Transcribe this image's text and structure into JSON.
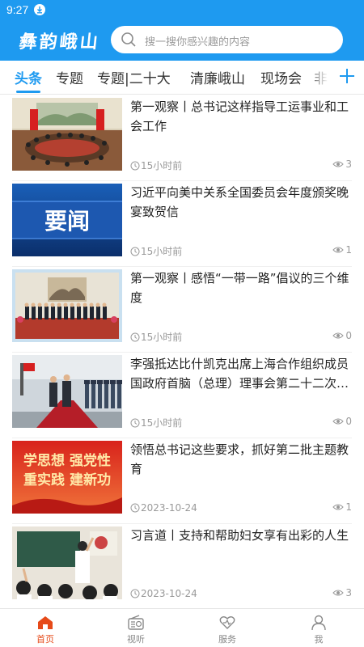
{
  "status": {
    "time": "9:27"
  },
  "header": {
    "logo": "彝韵峨山",
    "search_placeholder": "搜一搜你感兴趣的内容"
  },
  "tabs": [
    {
      "label": "头条",
      "active": true
    },
    {
      "label": "专题"
    },
    {
      "label": "专题|二十大"
    },
    {
      "label": "清廉峨山"
    },
    {
      "label": "现场会"
    },
    {
      "label": "非"
    }
  ],
  "thumb_text": {
    "news": "要闻",
    "slogan_1": "学思想  强党性",
    "slogan_2": "重实践  建新功"
  },
  "articles": [
    {
      "title": "第一观察丨总书记这样指导工运事业和工会工作",
      "time": "15小时前",
      "views": "3",
      "thumb": "meeting-room"
    },
    {
      "title": "习近平向美中关系全国委员会年度颁奖晚宴致贺信",
      "time": "15小时前",
      "views": "1",
      "thumb": "yaowen"
    },
    {
      "title": "第一观察丨感悟“一带一路”倡议的三个维度",
      "time": "15小时前",
      "views": "0",
      "thumb": "group-photo"
    },
    {
      "title": "李强抵达比什凯克出席上海合作组织成员国政府首脑（总理）理事会第二十二次会议",
      "time": "15小时前",
      "views": "0",
      "thumb": "honor-guard"
    },
    {
      "title": "领悟总书记这些要求，抓好第二批主题教育",
      "time": "2023-10-24",
      "views": "1",
      "thumb": "slogan"
    },
    {
      "title": "习言道丨支持和帮助妇女享有出彩的人生",
      "time": "2023-10-24",
      "views": "3",
      "thumb": "classroom"
    }
  ],
  "bottom_nav": [
    {
      "label": "首页",
      "icon": "home-icon",
      "active": true
    },
    {
      "label": "视听",
      "icon": "radio-icon"
    },
    {
      "label": "服务",
      "icon": "heart-hand-icon"
    },
    {
      "label": "我",
      "icon": "user-icon"
    }
  ],
  "colors": {
    "brand": "#1e9af0",
    "active_nav": "#e64a19"
  }
}
